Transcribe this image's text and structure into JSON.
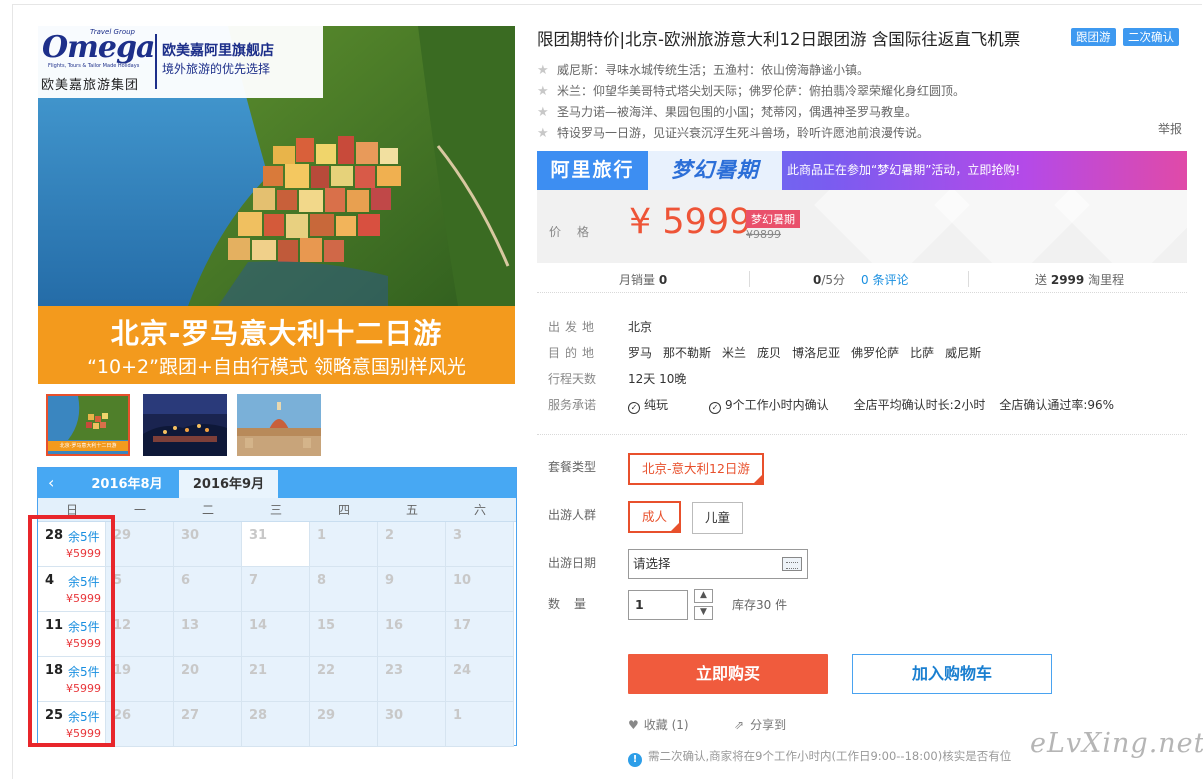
{
  "main_image": {
    "logo_brand": "Omega",
    "logo_travel_group": "Travel Group",
    "logo_sub": "Flights, Tours & Tailor Made Holidays",
    "logo_cn": "欧美嘉旅游集团",
    "shop_name": "欧美嘉阿里旗舰店",
    "slogan": "境外旅游的优先选择",
    "banner_title": "北京-罗马意大利十二日游",
    "banner_sub": "“10+2”跟团+自由行模式 领略意国别样风光"
  },
  "thumbnails": [
    {
      "caption": "北京-罗马意大利十二日游",
      "active": true
    },
    {
      "caption": "",
      "active": false
    },
    {
      "caption": "",
      "active": false
    }
  ],
  "calendar": {
    "prev_icon": "‹",
    "tabs": [
      "2016年8月",
      "2016年9月"
    ],
    "weekdays": [
      "日",
      "一",
      "二",
      "三",
      "四",
      "五",
      "六"
    ],
    "rows": [
      [
        {
          "d": "28",
          "left": "余5件",
          "price": "¥5999"
        },
        {
          "d": "29"
        },
        {
          "d": "30"
        },
        {
          "d": "31"
        },
        {
          "d": "1"
        },
        {
          "d": "2"
        },
        {
          "d": "3"
        }
      ],
      [
        {
          "d": "4",
          "left": "余5件",
          "price": "¥5999"
        },
        {
          "d": "5"
        },
        {
          "d": "6"
        },
        {
          "d": "7"
        },
        {
          "d": "8"
        },
        {
          "d": "9"
        },
        {
          "d": "10"
        }
      ],
      [
        {
          "d": "11",
          "left": "余5件",
          "price": "¥5999"
        },
        {
          "d": "12"
        },
        {
          "d": "13"
        },
        {
          "d": "14"
        },
        {
          "d": "15"
        },
        {
          "d": "16"
        },
        {
          "d": "17"
        }
      ],
      [
        {
          "d": "18",
          "left": "余5件",
          "price": "¥5999"
        },
        {
          "d": "19"
        },
        {
          "d": "20"
        },
        {
          "d": "21"
        },
        {
          "d": "22"
        },
        {
          "d": "23"
        },
        {
          "d": "24"
        }
      ],
      [
        {
          "d": "25",
          "left": "余5件",
          "price": "¥5999"
        },
        {
          "d": "26"
        },
        {
          "d": "27"
        },
        {
          "d": "28"
        },
        {
          "d": "29"
        },
        {
          "d": "30"
        },
        {
          "d": "1"
        }
      ]
    ]
  },
  "product": {
    "title": "限团期特价|北京-欧洲旅游意大利12日跟团游 含国际往返直飞机票",
    "tags": [
      "跟团游",
      "二次确认"
    ],
    "features": [
      "威尼斯：寻味水城传统生活；五渔村：依山傍海静谧小镇。",
      "米兰：仰望华美哥特式塔尖划天际；佛罗伦萨：俯拍翡冷翠荣耀化身红圆顶。",
      "圣马力诺—被海洋、果园包围的小国；梵蒂冈，偶遇神圣罗马教皇。",
      "特设罗马一日游，见证兴衰沉浮生死斗兽场，聆听许愿池前浪漫传说。"
    ],
    "report": "举报"
  },
  "promo": {
    "logo": "阿里旅行",
    "campaign": "梦幻暑期",
    "text": "此商品正在参加“梦幻暑期”活动，立即抢购!"
  },
  "price": {
    "label": "价格",
    "value": "¥ 5999",
    "tag": "梦幻暑期",
    "old": "¥9899"
  },
  "stats": {
    "monthly_label": "月销量",
    "monthly_value": "0",
    "rating": "0",
    "rating_suffix": "/5分",
    "reviews": "0 条评论",
    "points_prefix": "送",
    "points_value": "2999",
    "points_suffix": "淘里程"
  },
  "info": {
    "departure_label": "出发地",
    "departure_value": "北京",
    "destination_label": "目的地",
    "destinations": [
      "罗马",
      "那不勒斯",
      "米兰",
      "庞贝",
      "博洛尼亚",
      "佛罗伦萨",
      "比萨",
      "威尼斯"
    ],
    "days_label": "行程天数",
    "days_value": "12天 10晚",
    "service_label": "服务承诺",
    "services": [
      "纯玩",
      "9个工作小时内确认"
    ],
    "confirm_avg": "全店平均确认时长:2小时",
    "confirm_rate": "全店确认通过率:96%"
  },
  "options": {
    "package_label": "套餐类型",
    "package_value": "北京-意大利12日游",
    "people_label": "出游人群",
    "people": [
      "成人",
      "儿童"
    ],
    "date_label": "出游日期",
    "date_placeholder": "请选择",
    "qty_label": "数量",
    "qty_value": "1",
    "stock": "库存30 件"
  },
  "actions": {
    "buy": "立即购买",
    "cart": "加入购物车",
    "fav": "收藏 (1)",
    "share": "分享到"
  },
  "notice": "需二次确认,商家将在9个工作小时内(工作日9:00--18:00)核实是否有位",
  "watermark": "eLvXing.net",
  "colors": {
    "accent_red": "#f05b3d",
    "accent_blue": "#47a8f3",
    "banner_orange": "#f39a1d"
  }
}
